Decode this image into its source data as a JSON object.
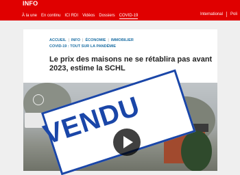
{
  "header": {
    "logo": "INFO",
    "nav": [
      "À la une",
      "En continu",
      "ICI RDI",
      "Vidéos",
      "Dossiers",
      "COVID-19"
    ],
    "right": [
      "International",
      "Poli"
    ]
  },
  "article": {
    "tags_row1": [
      "ACCUEIL",
      "INFO",
      "ÉCONOMIE",
      "IMMOBILIER"
    ],
    "tags_row2": "COVID-19 : TOUT SUR LA PANDÉMIE",
    "title": "Le prix des maisons ne se rétablira pas avant 2023, estime la SCHL",
    "sign_text": "VENDU"
  },
  "colors": {
    "brand": "#e00000",
    "link": "#1c6fa4",
    "sign_blue": "#1a46a8"
  }
}
